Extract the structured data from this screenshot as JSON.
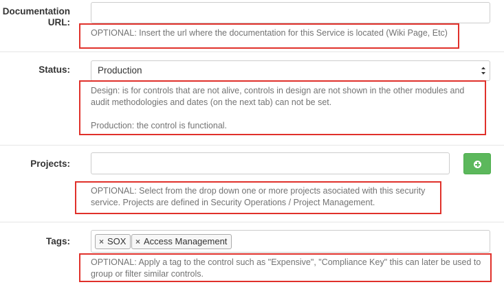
{
  "documentation": {
    "label_line1": "Documentation",
    "label_line2": "URL:",
    "value": "",
    "help": "OPTIONAL: Insert the url where the documentation for this Service is located (Wiki Page, Etc)"
  },
  "status": {
    "label": "Status:",
    "selected": "Production",
    "help_line1": "Design: is for controls that are not alive, controls in design are not shown in the other modules and",
    "help_line2": "audit methodologies and dates (on the next tab) can not be set.",
    "help_line3": "Production: the control is functional."
  },
  "projects": {
    "label": "Projects:",
    "value": "",
    "add_icon": "plus-circle-icon",
    "help_line1": "OPTIONAL: Select from the drop down one or more projects asociated with this security",
    "help_line2": "service. Projects are defined in Security Operations / Project Management."
  },
  "tags": {
    "label": "Tags:",
    "items": [
      {
        "remove": "×",
        "label": "SOX"
      },
      {
        "remove": "×",
        "label": "Access Management"
      }
    ],
    "help_line1": "OPTIONAL: Apply a tag to the control such as \"Expensive\", \"Compliance Key\" this can later be used to",
    "help_line2": "group or filter similar controls."
  },
  "colors": {
    "highlight_border": "#e0302a",
    "add_button": "#5cb85c",
    "help_text": "#737373"
  }
}
